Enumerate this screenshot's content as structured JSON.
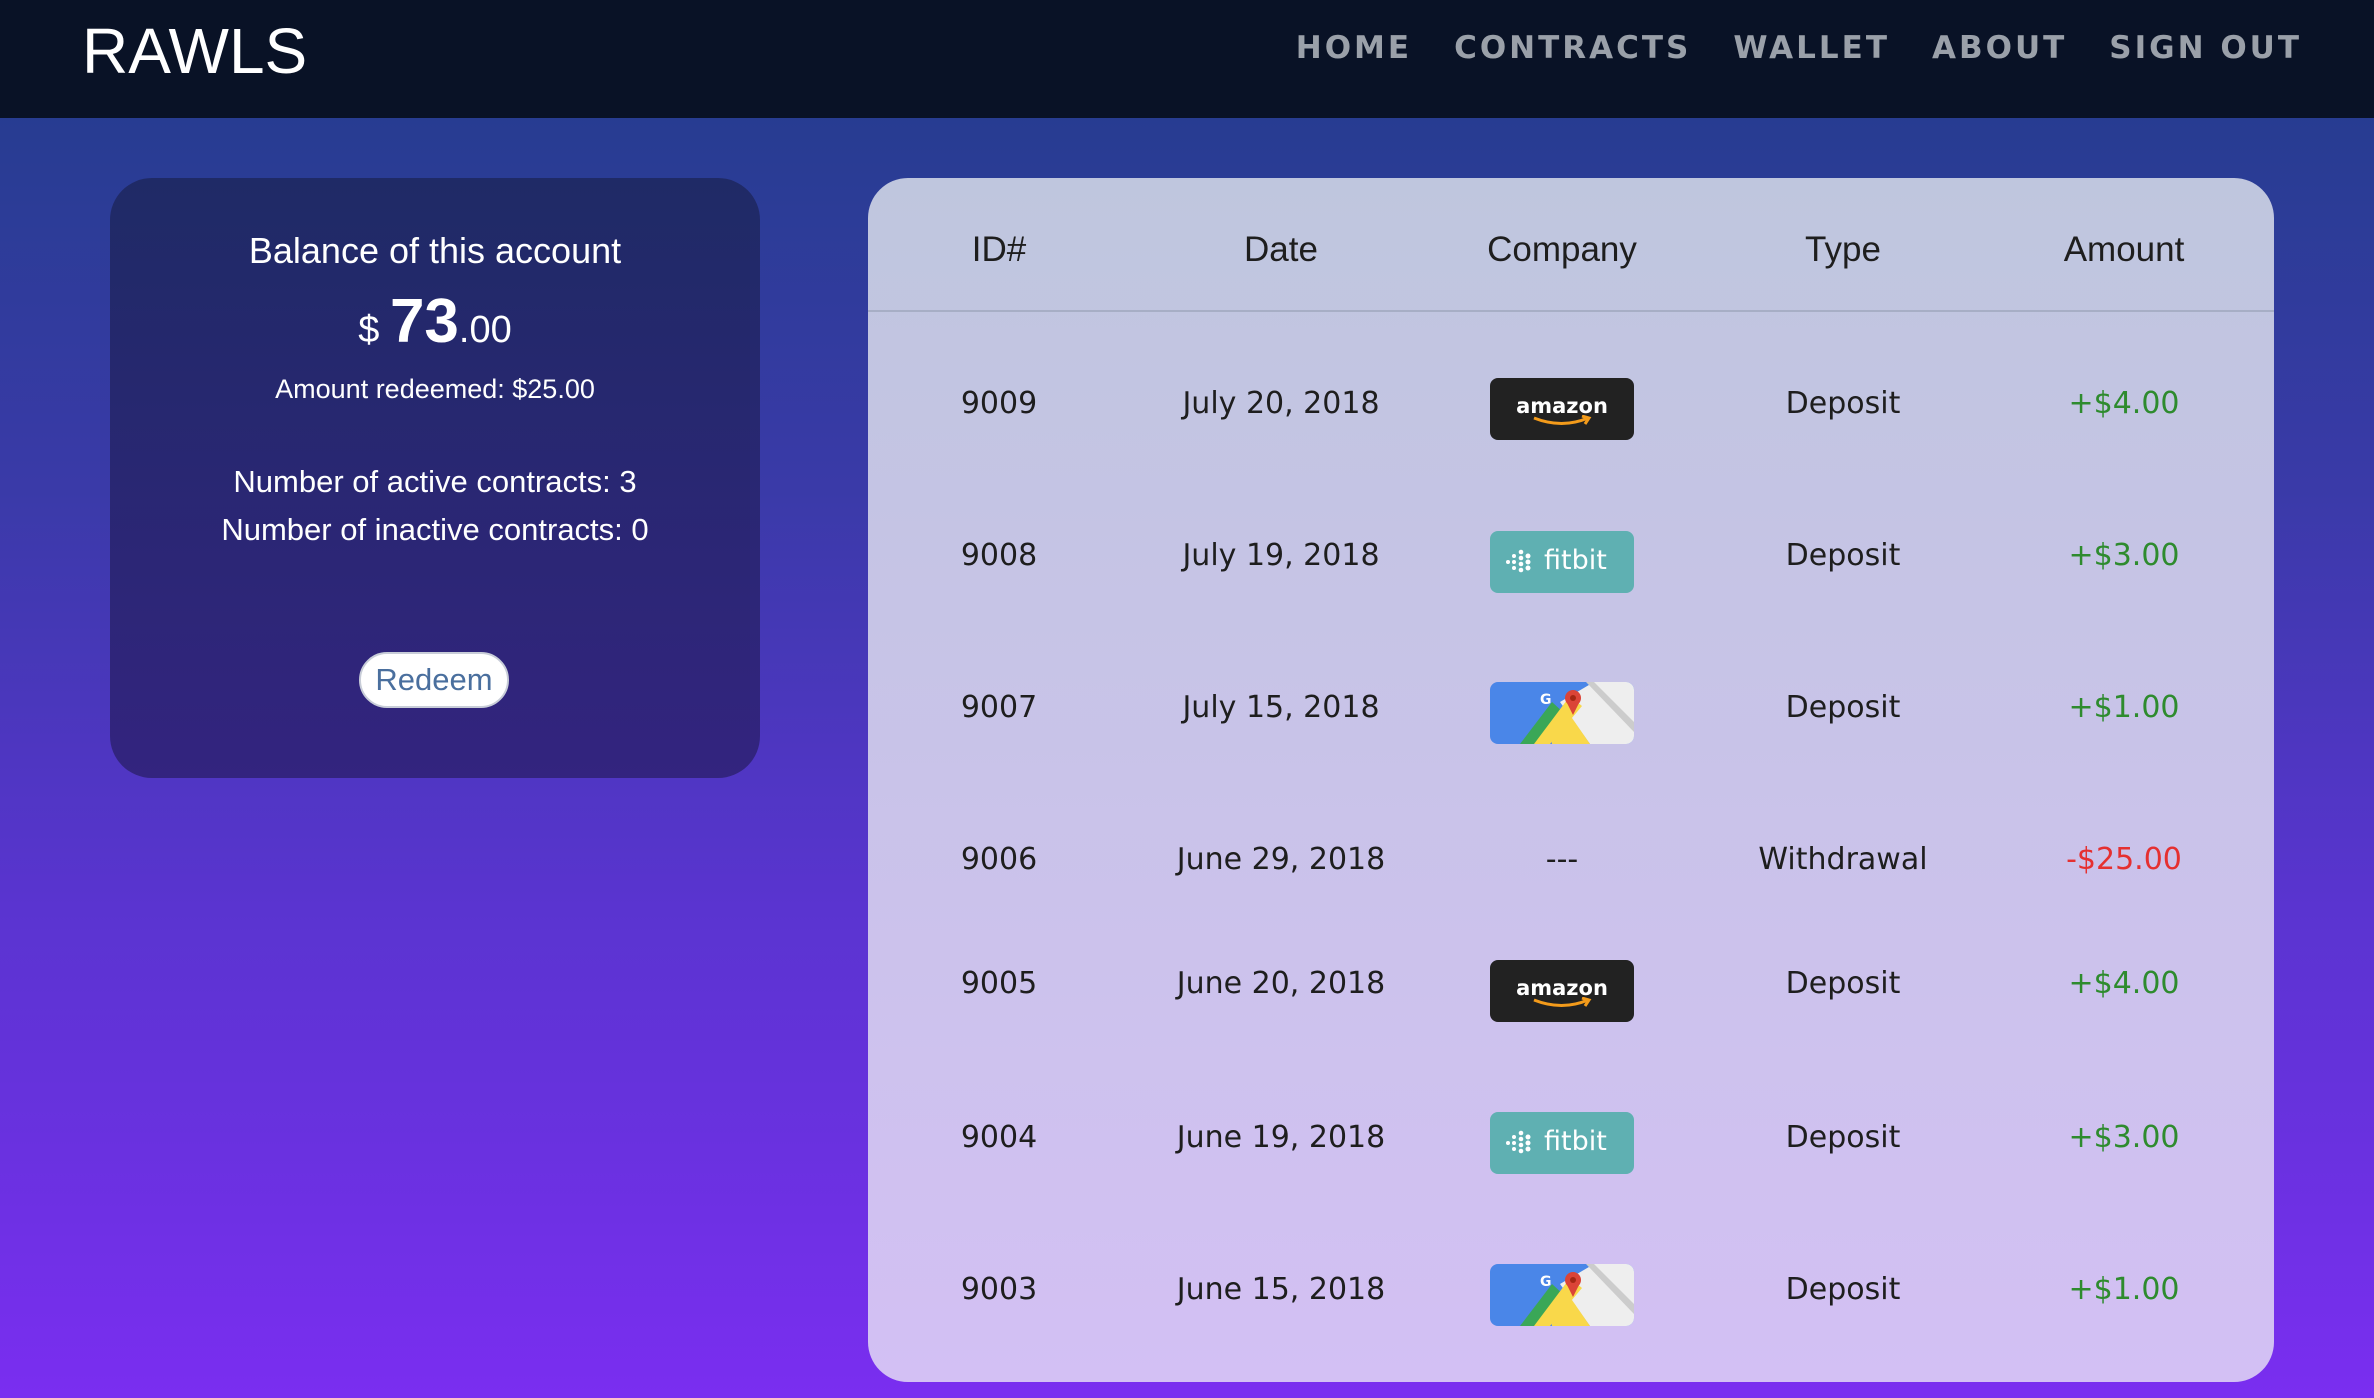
{
  "header": {
    "brand": "RAWLS",
    "nav": [
      "HOME",
      "CONTRACTS",
      "WALLET",
      "ABOUT",
      "SIGN OUT"
    ]
  },
  "balance": {
    "title": "Balance of this account",
    "currency": "$",
    "whole": "73",
    "cents": ".00",
    "redeemed": "Amount redeemed: $25.00",
    "active": "Number of active contracts: 3",
    "inactive": "Number of inactive contracts: 0",
    "redeem_label": "Redeem"
  },
  "table": {
    "headers": [
      "ID#",
      "Date",
      "Company",
      "Type",
      "Amount"
    ],
    "rows": [
      {
        "id": "9009",
        "date": "July 20, 2018",
        "company": "amazon",
        "company_icon": "amazon-logo",
        "type": "Deposit",
        "amount": "+$4.00"
      },
      {
        "id": "9008",
        "date": "July 19, 2018",
        "company": "fitbit",
        "company_icon": "fitbit-logo",
        "type": "Deposit",
        "amount": "+$3.00"
      },
      {
        "id": "9007",
        "date": "July 15, 2018",
        "company_icon": "google-maps-logo",
        "type": "Deposit",
        "amount": "+$1.00"
      },
      {
        "id": "9006",
        "date": "June 29, 2018",
        "company": "---",
        "type": "Withdrawal",
        "amount": "-$25.00"
      },
      {
        "id": "9005",
        "date": "June 20, 2018",
        "company": "amazon",
        "company_icon": "amazon-logo",
        "type": "Deposit",
        "amount": "+$4.00"
      },
      {
        "id": "9004",
        "date": "June 19, 2018",
        "company": "fitbit",
        "company_icon": "fitbit-logo",
        "type": "Deposit",
        "amount": "+$3.00"
      },
      {
        "id": "9003",
        "date": "June 15, 2018",
        "company_icon": "google-maps-logo",
        "type": "Deposit",
        "amount": "+$1.00"
      }
    ]
  },
  "colors": {
    "header_bg": "#091226",
    "positive": "#2e8b2e",
    "negative": "#e53030",
    "amazon_bg": "#222222",
    "fitbit_bg": "#5fb0b2"
  }
}
